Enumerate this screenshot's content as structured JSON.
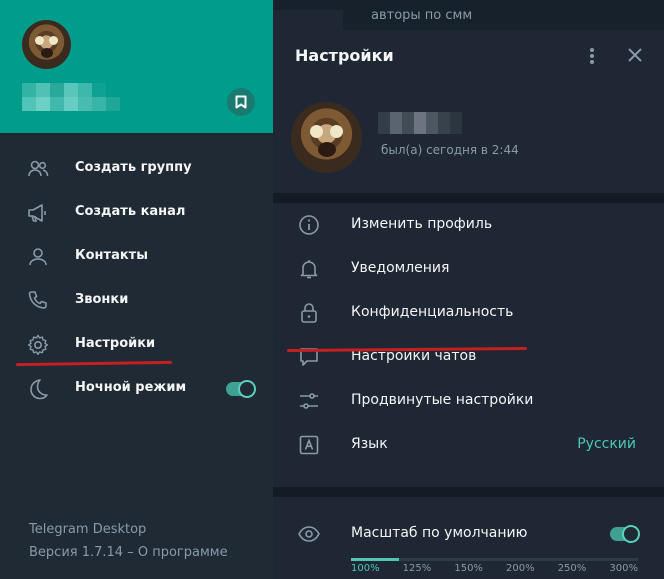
{
  "background_chat": {
    "title": "авторы по смм"
  },
  "sidebar": {
    "items": [
      {
        "label": "Создать группу",
        "icon": "group-icon"
      },
      {
        "label": "Создать канал",
        "icon": "megaphone-icon"
      },
      {
        "label": "Контакты",
        "icon": "contact-icon"
      },
      {
        "label": "Звонки",
        "icon": "phone-icon"
      },
      {
        "label": "Настройки",
        "icon": "gear-icon"
      },
      {
        "label": "Ночной режим",
        "icon": "moon-icon"
      }
    ],
    "night_mode_enabled": true,
    "footer": {
      "app_name": "Telegram Desktop",
      "version_line": "Версия 1.7.14 – О программе"
    }
  },
  "settings": {
    "title": "Настройки",
    "profile": {
      "status": "был(а) сегодня в 2:44"
    },
    "items": [
      {
        "label": "Изменить профиль",
        "icon": "info-icon"
      },
      {
        "label": "Уведомления",
        "icon": "bell-icon"
      },
      {
        "label": "Конфиденциальность",
        "icon": "lock-icon"
      },
      {
        "label": "Настройки чатов",
        "icon": "chat-bubble-icon"
      },
      {
        "label": "Продвинутые настройки",
        "icon": "sliders-icon"
      },
      {
        "label": "Язык",
        "icon": "language-icon",
        "value": "Русский"
      }
    ],
    "scale": {
      "label": "Масштаб по умолчанию",
      "enabled": true,
      "marks": [
        "100%",
        "125%",
        "150%",
        "200%",
        "250%",
        "300%"
      ]
    }
  },
  "colors": {
    "accent": "#009c8c",
    "accent_text": "#4ec7b5",
    "annotation": "#c51f22"
  }
}
